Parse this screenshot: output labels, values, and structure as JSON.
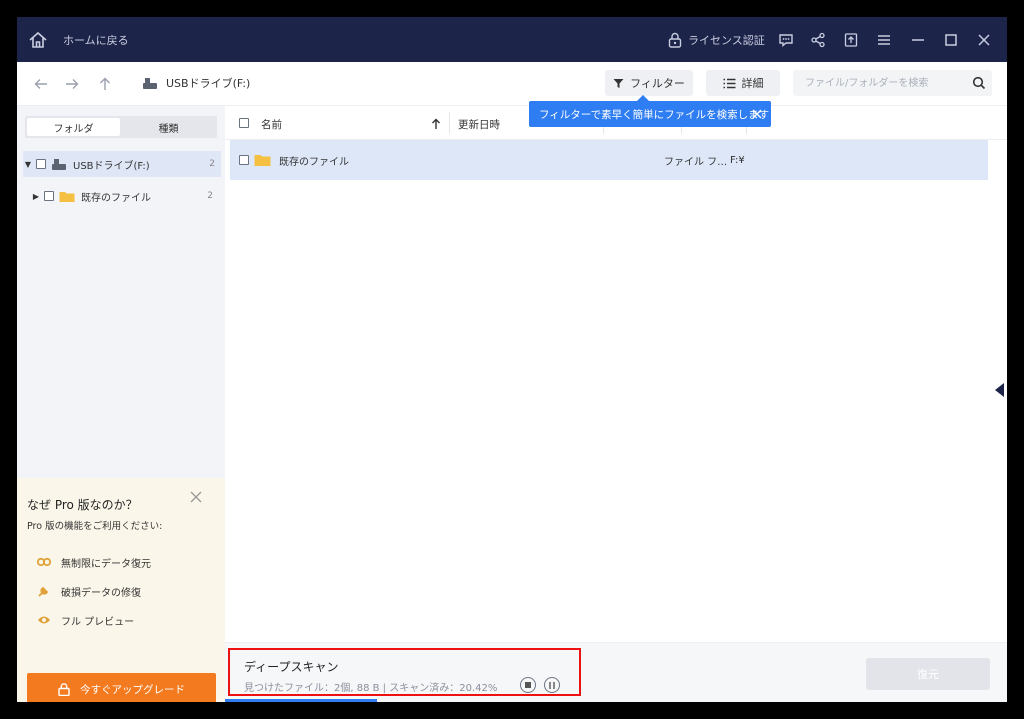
{
  "titlebar": {
    "back_label": "ホームに戻る",
    "license_label": "ライセンス認証",
    "icons": [
      "home-icon",
      "lock-icon",
      "feedback-icon",
      "share-icon",
      "upload-icon",
      "menu-icon",
      "minimize-icon",
      "maximize-icon",
      "close-icon"
    ]
  },
  "toolbar": {
    "path_label": "USBドライブ(F:)",
    "filter_label": "フィルター",
    "detail_label": "詳細",
    "search_placeholder": "ファイル/フォルダーを検索"
  },
  "sidebar": {
    "tabs": [
      "フォルダ",
      "種類"
    ],
    "active_tab": "フォルダ",
    "tree": [
      {
        "label": "USBドライブ(F:)",
        "count": "2",
        "expanded": true,
        "selected": true
      },
      {
        "label": "既存のファイル",
        "count": "2",
        "expanded": false,
        "selected": false
      }
    ]
  },
  "promo": {
    "title": "なぜ Pro 版なのか？",
    "subtitle": "Pro 版の機能をご利用ください:",
    "features": [
      "無制限にデータ復元",
      "破損データの修復",
      "フル プレビュー"
    ],
    "upgrade_label": "今すぐアップグレード"
  },
  "list": {
    "columns": {
      "name": "名前",
      "modified": "更新日時"
    },
    "sort_direction": "ascending",
    "rows": [
      {
        "name": "既存のファイル",
        "type": "ファイル フ…",
        "path": "F:¥"
      }
    ]
  },
  "tooltip": {
    "text": "フィルターで素早く簡単にファイルを検索します"
  },
  "scan": {
    "title": "ディープスキャン",
    "status": "見つけたファイル：2個, 88 B | スキャン済み：20.42%",
    "progress": 0.2042
  },
  "restore_label": "復元",
  "colors": {
    "titlebar_bg": "#1c2449",
    "accent_blue": "#2f7df2",
    "upgrade_orange": "#f47a1f",
    "selection": "#dde7f8",
    "highlight_border": "#ee1111"
  }
}
